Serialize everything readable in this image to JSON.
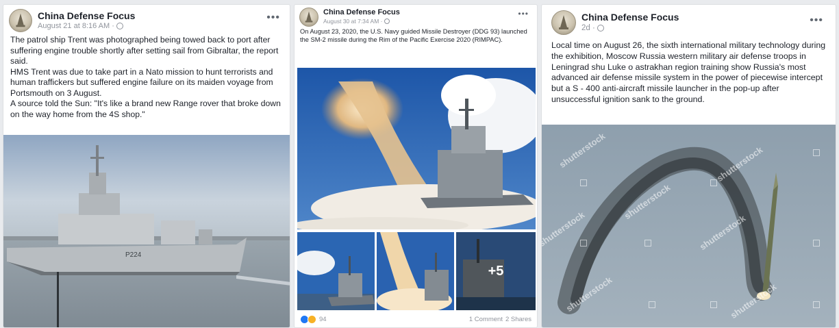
{
  "posts": [
    {
      "page_name": "China Defense Focus",
      "date": "August 21 at 8:16 AM ·",
      "text": [
        "The patrol ship Trent was photographed being towed back to port after suffering engine trouble shortly after setting sail from Gibraltar, the report said.",
        "HMS Trent was due to take part in a Nato mission to hunt terrorists and human traffickers but suffered engine failure on its maiden voyage from Portsmouth on 3 August.",
        "A source told the Sun: \"It's like a brand new Range rover that broke down on the way home from the 4S shop.\""
      ],
      "hull_number": "P224"
    },
    {
      "page_name": "China Defense Focus",
      "date": "August 30 at 7:34 AM ·",
      "text": [
        "On August 23, 2020, the U.S. Navy guided Missile Destroyer (DDG 93) launched the SM-2 missile during the Rim of the Pacific Exercise 2020 (RIMPAC)."
      ],
      "more_photos": "+5",
      "reaction_count": "94",
      "comments": "1 Comment",
      "shares": "2 Shares"
    },
    {
      "page_name": "China Defense Focus",
      "date": "2d ·",
      "text": [
        "Local time on August 26, the sixth international military technology during the exhibition, Moscow Russia western military air defense troops in Leningrad shu Luke o astrakhan region training show Russia's most advanced air defense missile system in the power of piecewise intercept but a S - 400 anti-aircraft missile launcher in the pop-up after unsuccessful ignition sank to the ground."
      ],
      "watermark": "shutterstock"
    }
  ],
  "icons": {
    "more": "more-icon",
    "globe": "globe-icon",
    "like": "like-reaction-icon",
    "wow": "wow-reaction-icon"
  },
  "colors": {
    "background": "#e9ebee",
    "card": "#ffffff",
    "text": "#1d2129",
    "meta": "#90949c",
    "like_blue": "#2078f4"
  }
}
